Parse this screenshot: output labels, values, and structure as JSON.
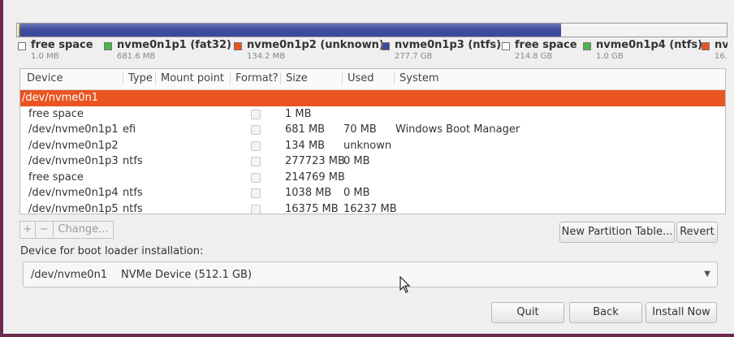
{
  "partition_bar": {
    "segments": [
      {
        "name": "free space",
        "fraction": 0.002,
        "color": "#f2f2f2"
      },
      {
        "name": "nvme0n1p1 (fat32)",
        "fraction": 0.002,
        "color": "#4bb64b"
      },
      {
        "name": "nvme0n1p2 (unknown)",
        "fraction": 0.001,
        "color": "#e95420"
      },
      {
        "name": "nvme0n1p3 (ntfs)",
        "fraction": 0.762,
        "color": "#3a4a9c"
      },
      {
        "name": "free space",
        "fraction": 0.233,
        "color": "#f2f2f2"
      }
    ]
  },
  "legend": [
    {
      "name": "free space",
      "size": "1.0 MB",
      "color": "#ffffff"
    },
    {
      "name": "nvme0n1p1 (fat32)",
      "size": "681.6 MB",
      "color": "#4bb64b"
    },
    {
      "name": "nvme0n1p2 (unknown)",
      "size": "134.2 MB",
      "color": "#e95420"
    },
    {
      "name": "nvme0n1p3 (ntfs)",
      "size": "277.7 GB",
      "color": "#3a4a9c"
    },
    {
      "name": "free space",
      "size": "214.8 GB",
      "color": "#ffffff"
    },
    {
      "name": "nvme0n1p4 (ntfs)",
      "size": "1.0 GB",
      "color": "#4bb64b"
    },
    {
      "name": "nv",
      "size": "16.",
      "color": "#e95420"
    }
  ],
  "table": {
    "headers": [
      "Device",
      "Type",
      "Mount point",
      "Format?",
      "Size",
      "Used",
      "System"
    ],
    "rows": [
      {
        "device": "/dev/nvme0n1",
        "type": "",
        "mount": "",
        "size": "",
        "used": "",
        "system": "",
        "selected": true,
        "checkbox": false
      },
      {
        "device": "free space",
        "type": "",
        "mount": "",
        "size": "1 MB",
        "used": "",
        "system": "",
        "selected": false,
        "checkbox": true
      },
      {
        "device": "/dev/nvme0n1p1",
        "type": "efi",
        "mount": "",
        "size": "681 MB",
        "used": "70 MB",
        "system": "Windows Boot Manager",
        "selected": false,
        "checkbox": true
      },
      {
        "device": "/dev/nvme0n1p2",
        "type": "",
        "mount": "",
        "size": "134 MB",
        "used": "unknown",
        "system": "",
        "selected": false,
        "checkbox": true
      },
      {
        "device": "/dev/nvme0n1p3",
        "type": "ntfs",
        "mount": "",
        "size": "277723 MB",
        "used": "0 MB",
        "system": "",
        "selected": false,
        "checkbox": true
      },
      {
        "device": "free space",
        "type": "",
        "mount": "",
        "size": "214769 MB",
        "used": "",
        "system": "",
        "selected": false,
        "checkbox": true
      },
      {
        "device": "/dev/nvme0n1p4",
        "type": "ntfs",
        "mount": "",
        "size": "1038 MB",
        "used": "0 MB",
        "system": "",
        "selected": false,
        "checkbox": true
      },
      {
        "device": "/dev/nvme0n1p5",
        "type": "ntfs",
        "mount": "",
        "size": "16375 MB",
        "used": "16237 MB",
        "system": "",
        "selected": false,
        "checkbox": true
      }
    ]
  },
  "toolbar": {
    "add_label": "+",
    "remove_label": "−",
    "change_label": "Change...",
    "new_table_label": "New Partition Table...",
    "revert_label": "Revert"
  },
  "bootloader": {
    "label": "Device for boot loader installation:",
    "device": "/dev/nvme0n1",
    "description": "NVMe Device (512.1 GB)"
  },
  "buttons": {
    "quit": "Quit",
    "back": "Back",
    "install": "Install Now"
  }
}
